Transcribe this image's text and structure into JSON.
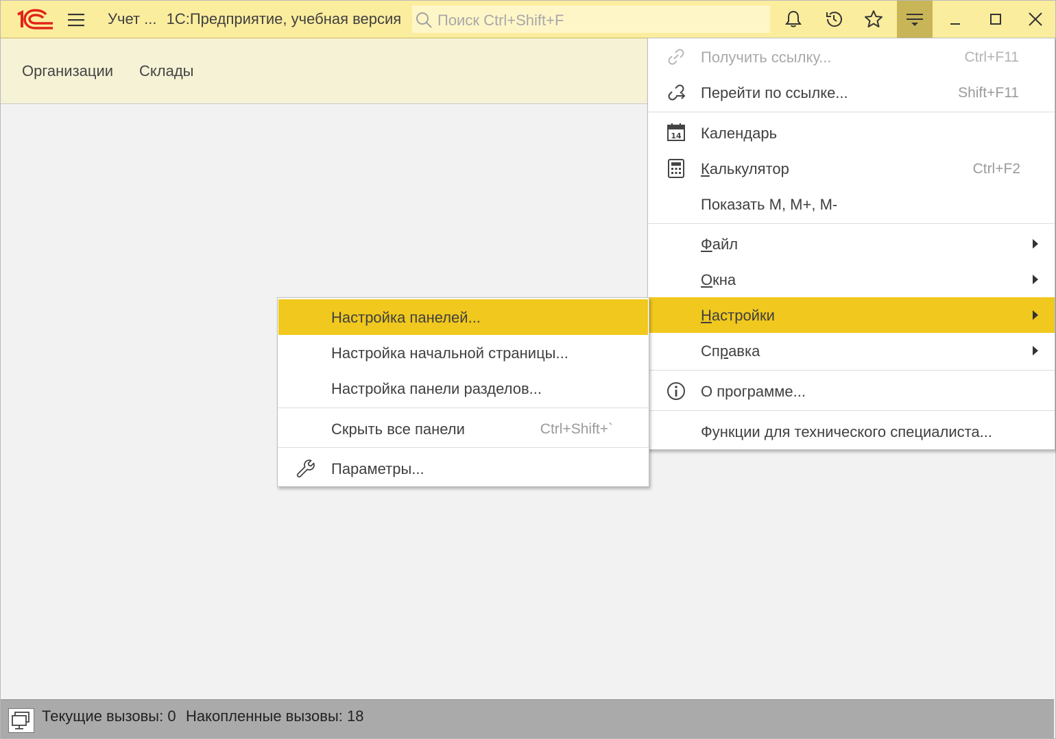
{
  "titlebar": {
    "app_title_short": "Учет ...",
    "app_title": "1С:Предприятие, учебная версия",
    "search_placeholder": "Поиск Ctrl+Shift+F"
  },
  "sections": {
    "items": [
      "Организации",
      "Склады"
    ]
  },
  "main_menu": {
    "items": [
      {
        "label": "Получить ссылку...",
        "shortcut": "Ctrl+F11",
        "icon": "link-icon",
        "disabled": true
      },
      {
        "label": "Перейти по ссылке...",
        "shortcut": "Shift+F11",
        "icon": "go-link-icon"
      },
      {
        "label": "Календарь",
        "shortcut": "",
        "icon": "calendar-icon",
        "icon_text": "14"
      },
      {
        "label_first": "К",
        "label_rest": "алькулятор",
        "shortcut": "Ctrl+F2",
        "icon": "calculator-icon"
      },
      {
        "label": "Показать M, M+, M-",
        "shortcut": ""
      },
      {
        "label_first": "Ф",
        "label_rest": "айл",
        "submenu": true
      },
      {
        "label_first": "О",
        "label_rest": "кна",
        "submenu": true
      },
      {
        "label_first": "Н",
        "label_rest": "астройки",
        "submenu": true,
        "highlighted": true
      },
      {
        "label_pre": "Сп",
        "label_first": "р",
        "label_rest": "авка",
        "submenu": true
      },
      {
        "label": "О программе...",
        "icon": "info-icon"
      },
      {
        "label": "Функции для технического специалиста..."
      }
    ]
  },
  "sub_menu": {
    "items": [
      {
        "label": "Настройка панелей...",
        "highlighted": true
      },
      {
        "label": "Настройка начальной страницы..."
      },
      {
        "label": "Настройка панели разделов..."
      },
      {
        "label": "Скрыть все панели",
        "shortcut": "Ctrl+Shift+`"
      },
      {
        "label": "Параметры...",
        "icon": "wrench-icon"
      }
    ]
  },
  "statusbar": {
    "current_calls": "Текущие вызовы: 0",
    "accumulated_calls": "Накопленные вызовы: 18"
  },
  "colors": {
    "titlebar_bg": "#fbed9e",
    "highlight": "#f0c81e",
    "logo_red": "#e2231a"
  }
}
